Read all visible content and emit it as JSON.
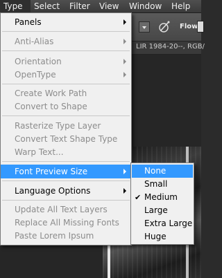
{
  "menubar": {
    "items": [
      {
        "label": "Type"
      },
      {
        "label": "Select"
      },
      {
        "label": "Filter"
      },
      {
        "label": "View"
      },
      {
        "label": "Window"
      },
      {
        "label": "Help"
      }
    ]
  },
  "options_bar": {
    "flow_label": "Flow:"
  },
  "document_tab": {
    "title": "LIR 1984-20--, RGB/"
  },
  "type_menu": {
    "items": [
      {
        "label": "Panels",
        "enabled": true,
        "submenu": true
      },
      {
        "label": "Anti-Alias",
        "enabled": false,
        "submenu": true
      },
      {
        "label": "Orientation",
        "enabled": false,
        "submenu": true
      },
      {
        "label": "OpenType",
        "enabled": false,
        "submenu": true
      },
      {
        "label": "Create Work Path",
        "enabled": false
      },
      {
        "label": "Convert to Shape",
        "enabled": false
      },
      {
        "label": "Rasterize Type Layer",
        "enabled": false
      },
      {
        "label": "Convert Text Shape Type",
        "enabled": false
      },
      {
        "label": "Warp Text...",
        "enabled": false
      },
      {
        "label": "Font Preview Size",
        "enabled": true,
        "submenu": true,
        "highlighted": true
      },
      {
        "label": "Language Options",
        "enabled": true,
        "submenu": true
      },
      {
        "label": "Update All Text Layers",
        "enabled": false
      },
      {
        "label": "Replace All Missing Fonts",
        "enabled": false
      },
      {
        "label": "Paste Lorem Ipsum",
        "enabled": false
      }
    ]
  },
  "font_preview_submenu": {
    "items": [
      {
        "label": "None",
        "highlighted": true
      },
      {
        "label": "Small"
      },
      {
        "label": "Medium",
        "checked": true
      },
      {
        "label": "Large"
      },
      {
        "label": "Extra Large"
      },
      {
        "label": "Huge"
      }
    ],
    "checkmark": "✔"
  },
  "colors": {
    "highlight": "#3399ff",
    "menu_bg": "#f0f0f0",
    "disabled_text": "#8c8c8c"
  }
}
